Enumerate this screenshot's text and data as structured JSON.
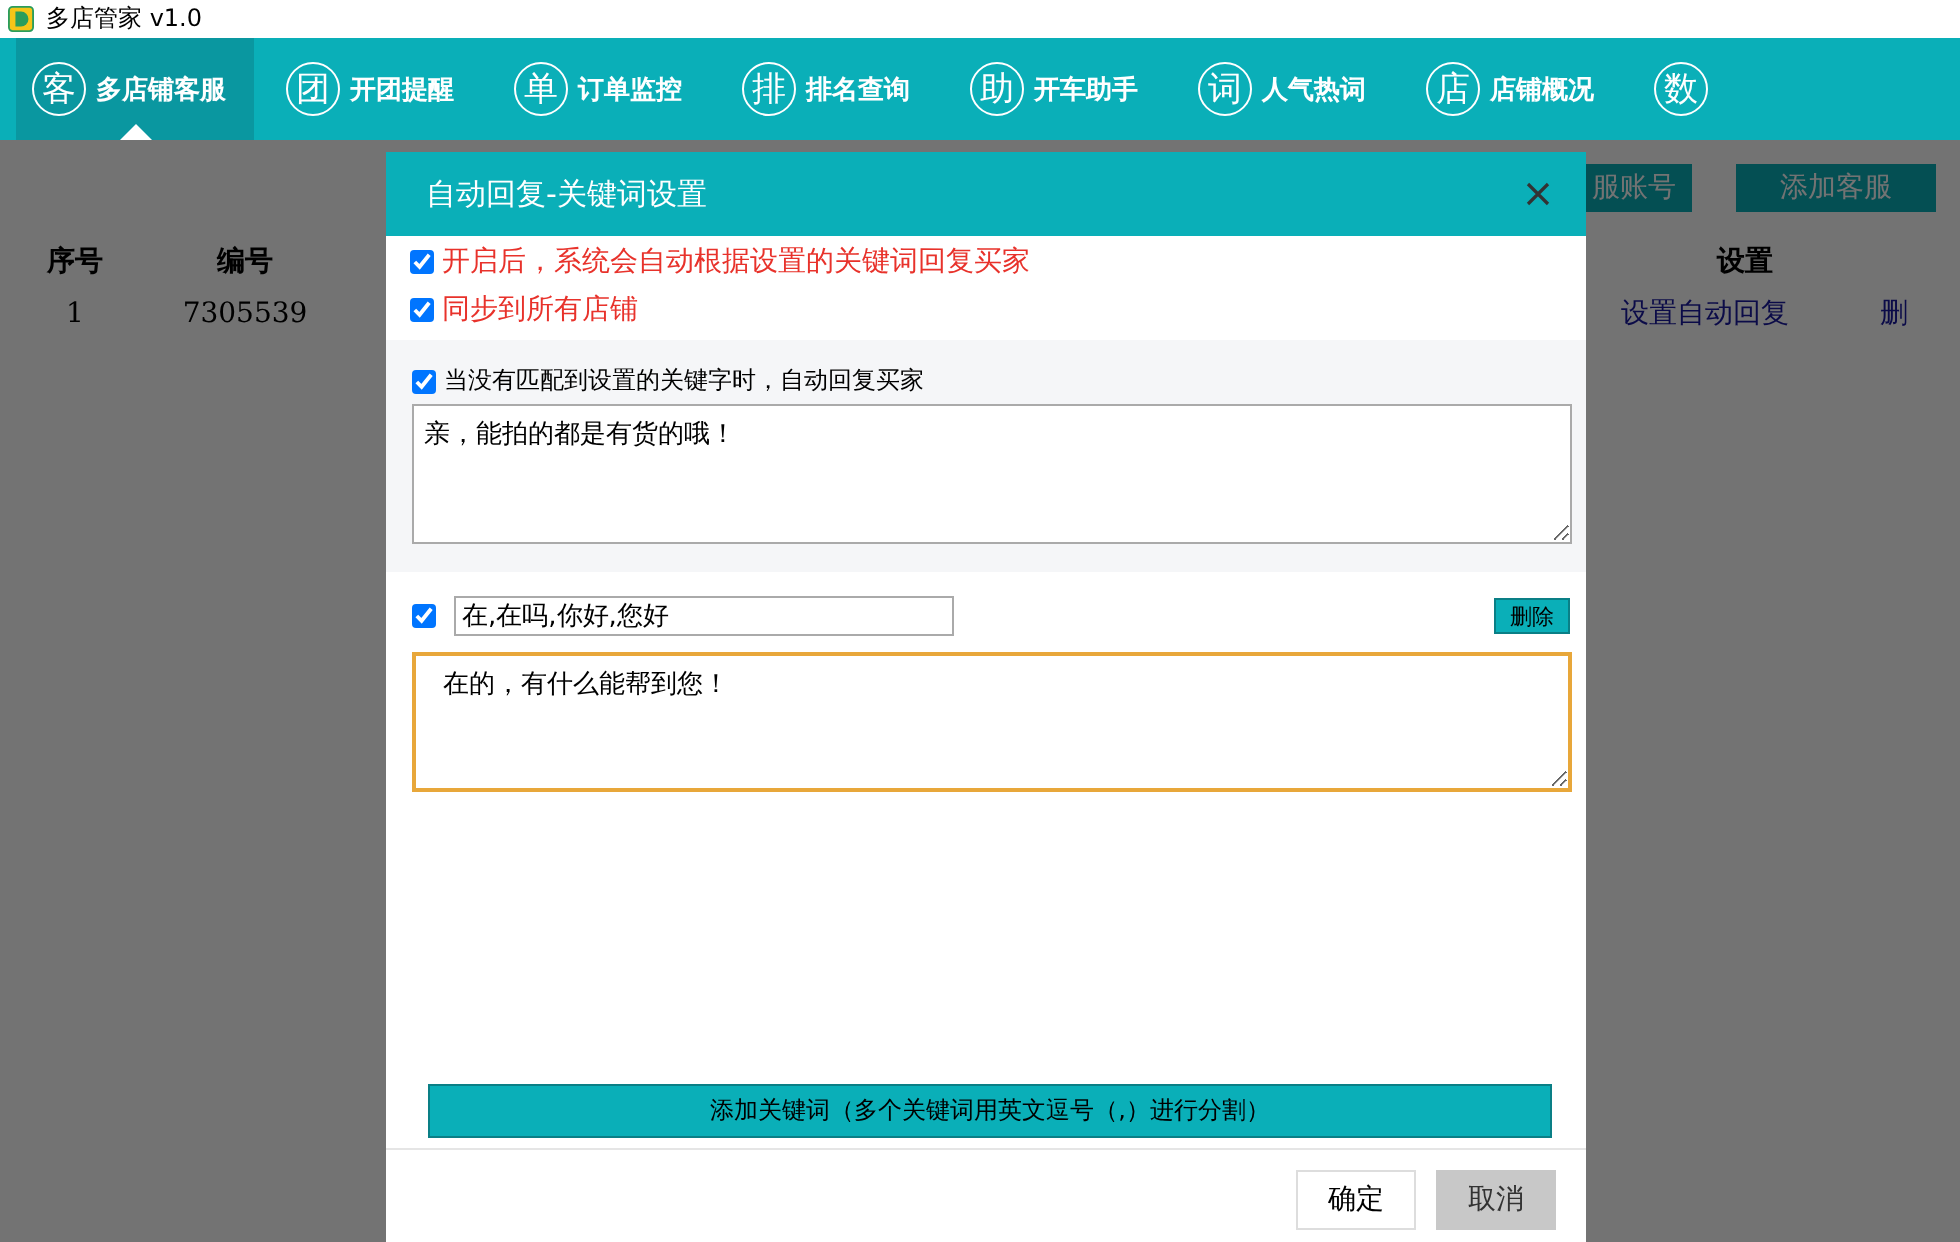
{
  "app": {
    "title": "多店管家 v1.0"
  },
  "nav": [
    {
      "icon_char": "客",
      "label": "多店铺客服",
      "selected": true
    },
    {
      "icon_char": "团",
      "label": "开团提醒",
      "selected": false
    },
    {
      "icon_char": "单",
      "label": "订单监控",
      "selected": false
    },
    {
      "icon_char": "排",
      "label": "排名查询",
      "selected": false
    },
    {
      "icon_char": "助",
      "label": "开车助手",
      "selected": false
    },
    {
      "icon_char": "词",
      "label": "人气热词",
      "selected": false
    },
    {
      "icon_char": "店",
      "label": "店铺概况",
      "selected": false
    },
    {
      "icon_char": "数",
      "selected": false
    }
  ],
  "page": {
    "buttons": [
      "服账号",
      "添加客服"
    ],
    "table": {
      "columns": [
        "序号",
        "编号",
        "设置"
      ],
      "rows": [
        {
          "cells": [
            "1",
            "7305539",
            "设置自动回复",
            "删"
          ]
        }
      ]
    }
  },
  "dialog": {
    "title": "自动回复-关键词设置",
    "options": [
      {
        "label": "开启后，系统会自动根据设置的关键词回复买家",
        "checked": true
      },
      {
        "label": "同步到所有店铺",
        "checked": true
      }
    ],
    "default_reply": {
      "label": "当没有匹配到设置的关键字时，自动回复买家",
      "checked": true,
      "value": "亲，能拍的都是有货的哦！"
    },
    "rules": [
      {
        "checked": true,
        "keywords": "在,在吗,你好,您好",
        "reply": "  在的，有什么能帮到您！",
        "focused": true,
        "delete_label": "删除"
      }
    ],
    "add_button": "添加关键词（多个关键词用英文逗号（,）进行分割）",
    "confirm": "确定",
    "cancel": "取消"
  }
}
